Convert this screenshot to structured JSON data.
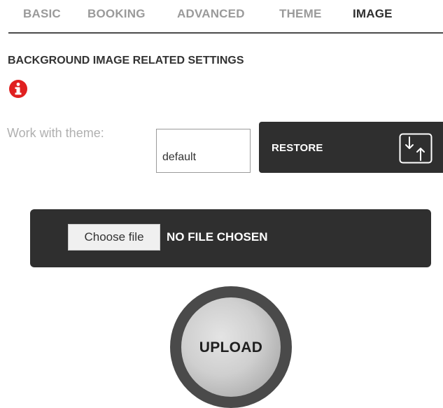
{
  "tabs": [
    {
      "label": "BASIC",
      "active": false
    },
    {
      "label": "BOOKING",
      "active": false
    },
    {
      "label": "ADVANCED",
      "active": false
    },
    {
      "label": "THEME",
      "active": false
    },
    {
      "label": "IMAGE",
      "active": true
    }
  ],
  "section": {
    "title": "BACKGROUND IMAGE RELATED SETTINGS",
    "info_icon": "info-circle-icon"
  },
  "theme": {
    "label": "Work with theme:",
    "value": "default"
  },
  "restore": {
    "label": "RESTORE",
    "icon": "import-export-icon"
  },
  "file": {
    "choose_label": "Choose file",
    "status": "NO FILE CHOSEN"
  },
  "upload": {
    "label": "UPLOAD"
  },
  "colors": {
    "accent_red": "#e02020",
    "dark_panel": "#2f2f2f",
    "tab_inactive": "#9a9a9a",
    "tab_active": "#2f2f2f"
  }
}
